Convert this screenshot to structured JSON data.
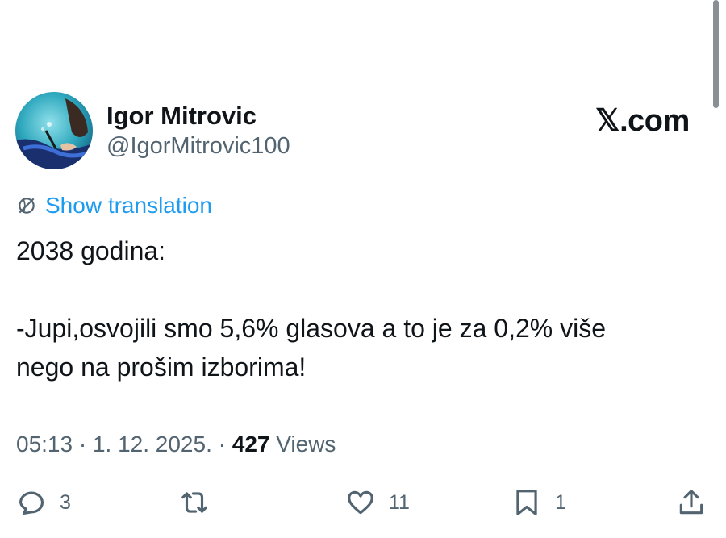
{
  "author": {
    "display_name": "Igor Mitrovic",
    "handle": "@IgorMitrovic100",
    "avatar_icon": "avatar-photo"
  },
  "brand": {
    "label": "𝕏.com"
  },
  "translation": {
    "label": "Show translation",
    "icon": "globe-icon"
  },
  "tweet": {
    "lines": [
      "2038 godina:",
      "-Jupi,osvojili smo 5,6% glasova a to je za 0,2% više",
      "nego na prošim izborima!"
    ]
  },
  "meta": {
    "time_date": "05:13 · 1. 12. 2025. · ",
    "views_count": "427",
    "views_label": " Views"
  },
  "actions": {
    "reply_count": "3",
    "retweet_count": "",
    "like_count": "11",
    "bookmark_count": "1"
  },
  "colors": {
    "text": "#0f1419",
    "secondary": "#536471",
    "link": "#1d9bf0"
  }
}
